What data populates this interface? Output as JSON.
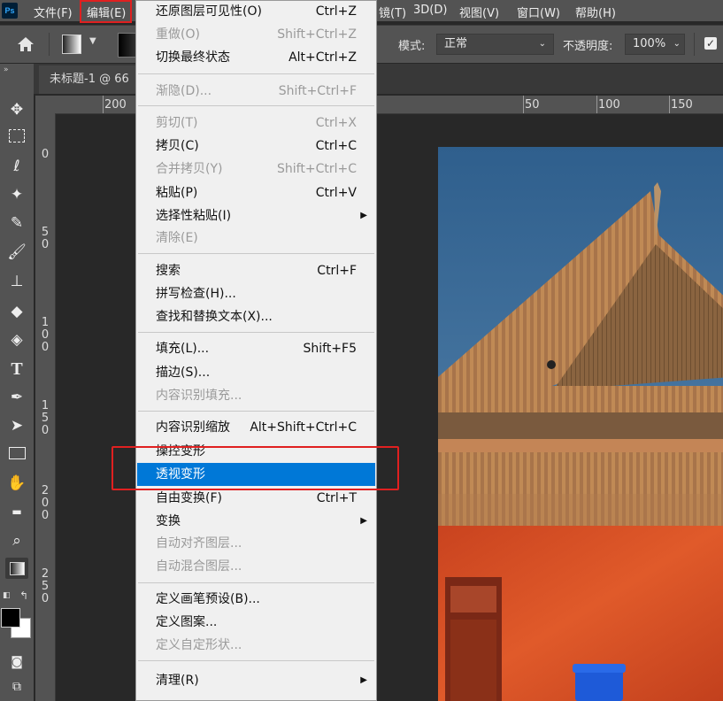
{
  "app": {
    "logo_text": "Ps"
  },
  "menubar": {
    "file": "文件(F)",
    "edit": "编辑(E)",
    "text_partial": "镜(T)",
    "view3d": "3D(D)",
    "view": "视图(V)",
    "window": "窗口(W)",
    "help": "帮助(H)"
  },
  "options": {
    "mode_label": "模式:",
    "mode_value": "正常",
    "opacity_label": "不透明度:",
    "opacity_value": "100%"
  },
  "document": {
    "tab_title": "未标题-1 @ 66"
  },
  "ruler": {
    "h_ticks": [
      "200",
      "50",
      "100",
      "150"
    ],
    "v_ticks": [
      [
        "0"
      ],
      [
        "5",
        "0"
      ],
      [
        "1",
        "0",
        "0"
      ],
      [
        "1",
        "5",
        "0"
      ],
      [
        "2",
        "0",
        "0"
      ],
      [
        "2",
        "5",
        "0"
      ]
    ]
  },
  "edit_menu": {
    "undo": {
      "label": "还原图层可见性(O)",
      "shortcut": "Ctrl+Z"
    },
    "redo": {
      "label": "重做(O)",
      "shortcut": "Shift+Ctrl+Z"
    },
    "toggle_last": {
      "label": "切换最终状态",
      "shortcut": "Alt+Ctrl+Z"
    },
    "fade": {
      "label": "渐隐(D)...",
      "shortcut": "Shift+Ctrl+F"
    },
    "cut": {
      "label": "剪切(T)",
      "shortcut": "Ctrl+X"
    },
    "copy": {
      "label": "拷贝(C)",
      "shortcut": "Ctrl+C"
    },
    "copy_merged": {
      "label": "合并拷贝(Y)",
      "shortcut": "Shift+Ctrl+C"
    },
    "paste": {
      "label": "粘贴(P)",
      "shortcut": "Ctrl+V"
    },
    "paste_special": {
      "label": "选择性粘贴(I)"
    },
    "clear": {
      "label": "清除(E)"
    },
    "search": {
      "label": "搜索",
      "shortcut": "Ctrl+F"
    },
    "spell_check": {
      "label": "拼写检查(H)..."
    },
    "find_replace": {
      "label": "查找和替换文本(X)..."
    },
    "fill": {
      "label": "填充(L)...",
      "shortcut": "Shift+F5"
    },
    "stroke": {
      "label": "描边(S)..."
    },
    "content_fill": {
      "label": "内容识别填充..."
    },
    "content_scale": {
      "label": "内容识别缩放",
      "shortcut": "Alt+Shift+Ctrl+C"
    },
    "puppet_warp": {
      "label": "操控变形"
    },
    "perspective_warp": {
      "label": "透视变形"
    },
    "free_transform": {
      "label": "自由变换(F)",
      "shortcut": "Ctrl+T"
    },
    "transform": {
      "label": "变换"
    },
    "auto_align": {
      "label": "自动对齐图层..."
    },
    "auto_blend": {
      "label": "自动混合图层..."
    },
    "define_brush": {
      "label": "定义画笔预设(B)..."
    },
    "define_pattern": {
      "label": "定义图案..."
    },
    "define_shape": {
      "label": "定义自定形状..."
    },
    "purge": {
      "label": "清理(R)"
    }
  },
  "colors": {
    "highlight": "#0078d7",
    "annotation": "#e02020",
    "menu_bg": "#f0f0f0",
    "workspace": "#282828"
  }
}
